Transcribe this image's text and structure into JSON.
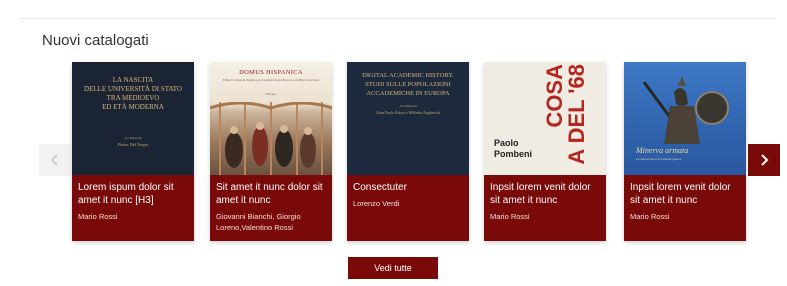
{
  "section": {
    "title": "Nuovi catalogati"
  },
  "carousel": {
    "books": [
      {
        "cover": {
          "lines": [
            "LA NASCITA",
            "DELLE UNIVERSITÀ DI STATO",
            "TRA MEDIOEVO",
            "ED ETÀ MODERNA"
          ],
          "sub": "A CURA DI",
          "editor": "Pietro Del Negro"
        },
        "title": "Lorem ispum dolor sit amet it nunc [H3]",
        "author": "Mario Rossi"
      },
      {
        "cover": {
          "lines": [
            "DOMUS HISPANICA"
          ],
          "sub": "El Real Colegio de España y el Cardenal Gil de Albornoz en la Historia del Arte",
          "editor": "Bologna"
        },
        "title": "Sit amet it nunc dolor sit amet it nunc",
        "author": "Giovanni Bianchi, Giorgio Loreno,Valentino Rossi"
      },
      {
        "cover": {
          "lines": [
            "DIGITAL ACADEMIC HISTORY.",
            "STUDI SULLE POPOLAZIONI",
            "ACCADEMICHE IN EUROPA"
          ],
          "sub": "A CURA DI",
          "editor": "Gian Paolo Brizzi e Wilhelm Engbrecht"
        },
        "title": "Consectuter",
        "author": "Lorenzo Verdi"
      },
      {
        "cover": {
          "author_first": "Paolo",
          "author_last": "Pombeni",
          "big_1": "COSA",
          "big_2": "A DEL '68"
        },
        "title": "Inpsit lorem venit dolor sit amet it nunc",
        "author": "Mario Rossi"
      },
      {
        "cover": {
          "lines": [
            "Minerva armata"
          ],
          "sub": "Le università e la Grande guerra"
        },
        "title": "Inpsit lorem venit dolor sit amet it nunc",
        "author": "Mario Rossi"
      }
    ]
  },
  "see_all_label": "Vedi tutte",
  "colors": {
    "brand": "#7a0a0a",
    "arrow_bg": "#f2f2f2"
  },
  "icons": {
    "prev": "chevron-left-icon",
    "next": "chevron-right-icon"
  }
}
